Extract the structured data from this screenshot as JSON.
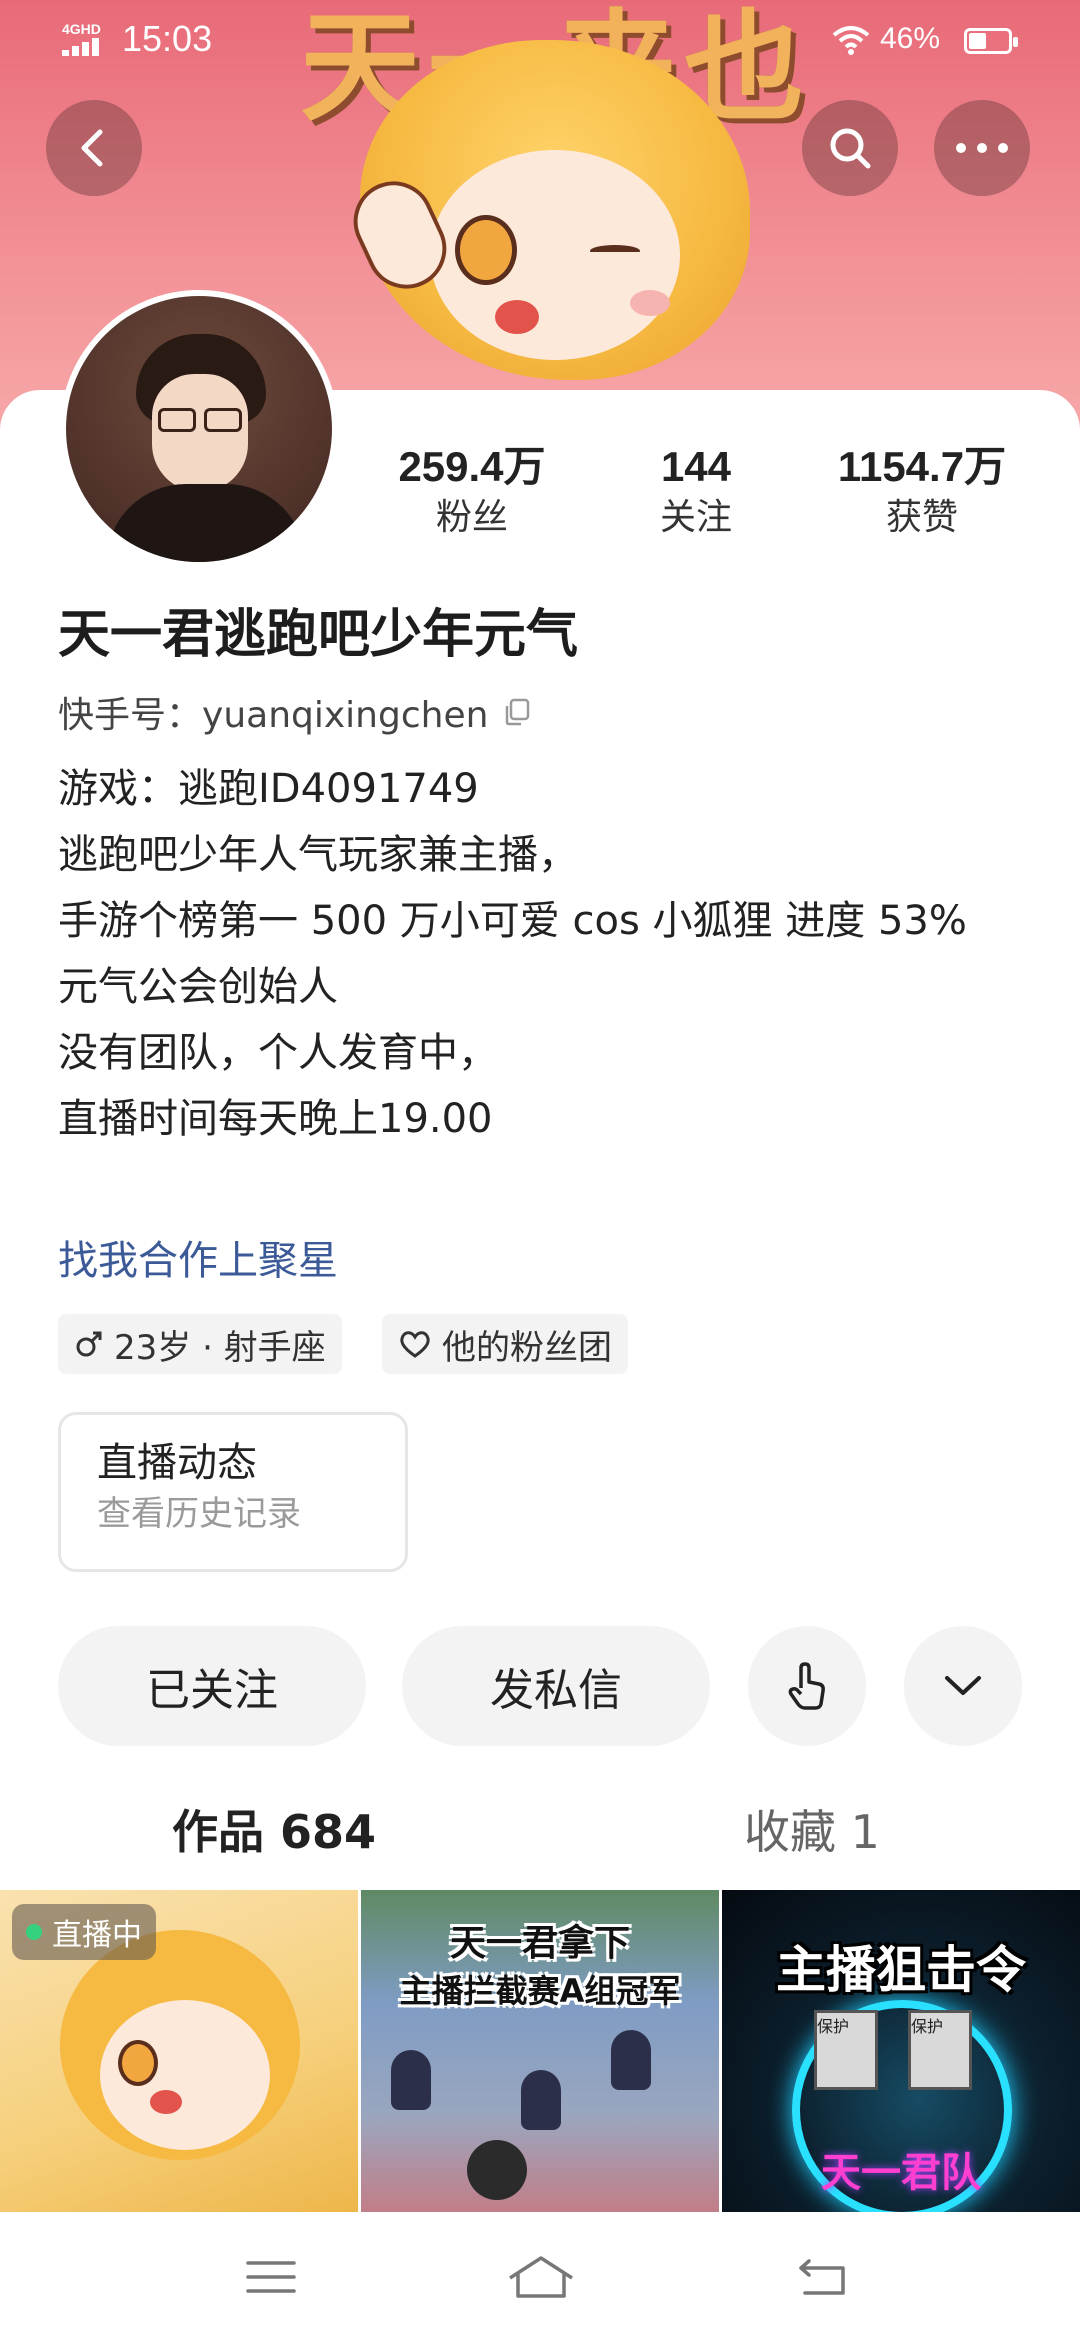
{
  "status_bar": {
    "network": "4GHD",
    "time": "15:03",
    "battery": "46%",
    "battery_level": 0.46
  },
  "banner": {
    "title_art": "天一来也"
  },
  "profile": {
    "stats": [
      {
        "value": "259.4万",
        "label": "粉丝"
      },
      {
        "value": "144",
        "label": "关注"
      },
      {
        "value": "1154.7万",
        "label": "获赞"
      }
    ],
    "name": "天一君逃跑吧少年元气",
    "kuaishou_id_label": "快手号：",
    "kuaishou_id": "yuanqixingchen",
    "bio_lines": [
      "游戏：逃跑ID4091749",
      "逃跑吧少年人气玩家兼主播，",
      "手游个榜第一  500 万小可爱 cos 小狐狸  进度 53%",
      "元气公会创始人",
      "没有团队，个人发育中，",
      "直播时间每天晚上19.00"
    ],
    "link_text": "找我合作上聚星",
    "tags": {
      "age_zodiac": "23岁 · 射手座",
      "fan_club": "他的粉丝团"
    },
    "live_history": {
      "title": "直播动态",
      "subtitle": "查看历史记录"
    }
  },
  "actions": {
    "followed": "已关注",
    "message": "发私信"
  },
  "tabs": {
    "works": "作品 684",
    "favorites": "收藏 1"
  },
  "grid": {
    "item1": {
      "badge": "直播中"
    },
    "item2": {
      "line1": "天一君拿下",
      "line2": "主播拦截赛A组冠军"
    },
    "item3": {
      "title": "主播狙击令",
      "cards": [
        "保护",
        "保护"
      ],
      "bottom": "天一君队"
    }
  },
  "colors": {
    "link": "#3c5a98",
    "live_dot": "#34d17e",
    "banner_top": "#e86a78"
  },
  "icons": {
    "back": "back-arrow-icon",
    "search": "search-icon",
    "more": "more-dots-icon",
    "copy": "copy-icon",
    "male": "male-icon",
    "heart": "heart-icon",
    "poke": "poke-hand-icon",
    "expand": "chevron-down-icon"
  }
}
